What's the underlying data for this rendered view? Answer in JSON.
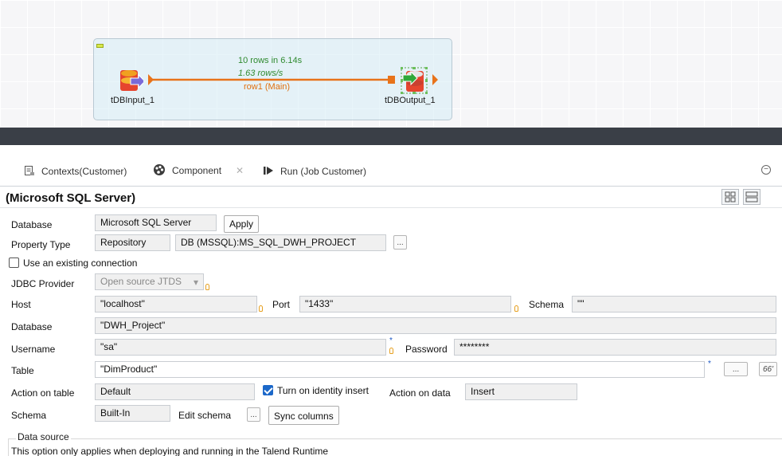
{
  "canvas": {
    "input_component": {
      "label": "tDBInput_1",
      "icon": "db-input-icon"
    },
    "output_component": {
      "label": "tDBOutput_1",
      "icon": "db-output-icon"
    },
    "flow": {
      "rows_stat": "10 rows in 6.14s",
      "rate_stat": "1.63 rows/s",
      "row_label": "row1 (Main)"
    }
  },
  "tabs": [
    {
      "label": "Contexts(Customer)",
      "icon": "contexts-icon"
    },
    {
      "label": "Component",
      "icon": "component-palette-icon",
      "active": true
    },
    {
      "label": "Run (Job Customer)",
      "icon": "run-icon"
    }
  ],
  "panel": {
    "title": "(Microsoft SQL Server)",
    "database_type": {
      "label": "Database",
      "value": "Microsoft SQL Server",
      "apply_label": "Apply"
    },
    "property_type": {
      "label": "Property Type",
      "value": "Repository",
      "repo_value": "DB (MSSQL):MS_SQL_DWH_PROJECT",
      "browse_label": "..."
    },
    "existing_connection": {
      "label": "Use an existing connection",
      "checked": false
    },
    "jdbc_provider": {
      "label": "JDBC Provider",
      "value": "Open source JTDS"
    },
    "host": {
      "label": "Host",
      "value": "\"localhost\""
    },
    "port": {
      "label": "Port",
      "value": "\"1433\""
    },
    "schema_field": {
      "label": "Schema",
      "value": "\"\""
    },
    "database_name": {
      "label": "Database",
      "value": "\"DWH_Project\""
    },
    "username": {
      "label": "Username",
      "value": "\"sa\""
    },
    "password": {
      "label": "Password",
      "value": "********"
    },
    "table": {
      "label": "Table",
      "value": "\"DimProduct\"",
      "browse_label": "...",
      "preview_label": "66'"
    },
    "action_on_table": {
      "label": "Action on table",
      "value": "Default"
    },
    "identity_insert": {
      "label": "Turn on identity insert",
      "checked": true
    },
    "action_on_data": {
      "label": "Action on data",
      "value": "Insert"
    },
    "schema": {
      "label": "Schema",
      "value": "Built-In",
      "edit_label": "Edit schema",
      "edit_btn": "...",
      "sync_label": "Sync columns"
    },
    "data_source": {
      "legend": "Data source",
      "note": "This option only applies when deploying and running in the Talend Runtime"
    }
  },
  "colors": {
    "flow_line": "#e8731a",
    "stats_green": "#2f8a2f",
    "checkbox_blue": "#1c68c9",
    "separator": "#3a3f47"
  }
}
